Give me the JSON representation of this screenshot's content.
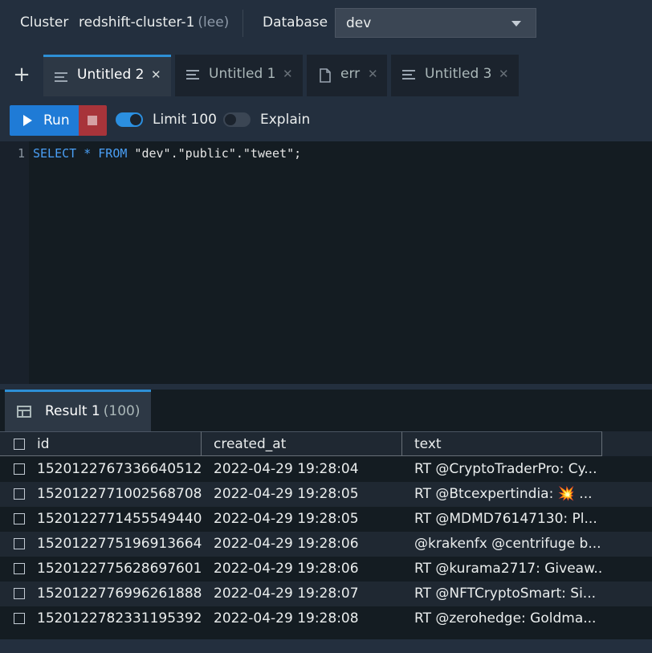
{
  "header": {
    "cluster_label": "Cluster",
    "cluster_name": "redshift-cluster-1",
    "cluster_user": "(lee)",
    "database_label": "Database",
    "database_value": "dev"
  },
  "tabs": [
    {
      "label": "Untitled 2",
      "icon": "query-icon",
      "active": true
    },
    {
      "label": "Untitled 1",
      "icon": "query-icon",
      "active": false
    },
    {
      "label": "err",
      "icon": "file-icon",
      "active": false
    },
    {
      "label": "Untitled 3",
      "icon": "query-icon",
      "active": false
    }
  ],
  "add_tab_glyph": "+",
  "close_glyph": "✕",
  "toolbar": {
    "run_label": "Run",
    "limit_label": "Limit 100",
    "limit_on": true,
    "explain_label": "Explain",
    "explain_on": false
  },
  "editor": {
    "line_number": "1",
    "tokens": [
      {
        "text": "SELECT",
        "kw": true
      },
      {
        "text": " ",
        "kw": false
      },
      {
        "text": "*",
        "kw": true
      },
      {
        "text": " ",
        "kw": false
      },
      {
        "text": "FROM",
        "kw": true
      },
      {
        "text": " \"dev\".\"public\".\"tweet\";",
        "kw": false
      }
    ]
  },
  "results": {
    "tab_label": "Result 1",
    "count": "(100)",
    "columns": [
      "id",
      "created_at",
      "text"
    ],
    "rows": [
      {
        "id": "1520122767336640512",
        "created_at": "2022-04-29 19:28:04",
        "text": "RT @CryptoTraderPro: Cy..."
      },
      {
        "id": "1520122771002568708",
        "created_at": "2022-04-29 19:28:05",
        "text": "RT @Btcexpertindia: 💥 ..."
      },
      {
        "id": "1520122771455549440",
        "created_at": "2022-04-29 19:28:05",
        "text": "RT @MDMD76147130: Pl..."
      },
      {
        "id": "1520122775196913664",
        "created_at": "2022-04-29 19:28:06",
        "text": "@krakenfx @centrifuge b..."
      },
      {
        "id": "1520122775628697601",
        "created_at": "2022-04-29 19:28:06",
        "text": "RT @kurama2717: Giveaw..."
      },
      {
        "id": "1520122776996261888",
        "created_at": "2022-04-29 19:28:07",
        "text": "RT @NFTCryptoSmart: Si..."
      },
      {
        "id": "1520122782331195392",
        "created_at": "2022-04-29 19:28:08",
        "text": "RT @zerohedge: Goldma..."
      }
    ]
  }
}
